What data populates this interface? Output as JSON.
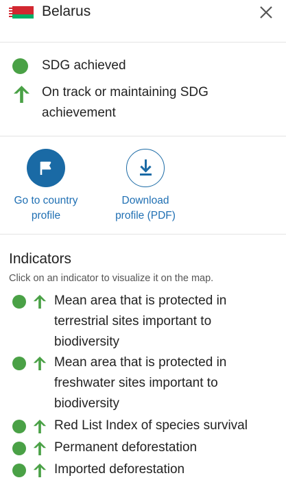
{
  "header": {
    "country": "Belarus"
  },
  "legend": [
    {
      "status": "SDG achieved"
    },
    {
      "status": "On track or maintaining SDG achievement",
      "line1": "On track or maintaining SDG",
      "line2": "achievement"
    }
  ],
  "actions": {
    "country_profile": {
      "line1": "Go to country",
      "line2": "profile"
    },
    "download": {
      "line1": "Download",
      "line2": "profile (PDF)"
    }
  },
  "indicators": {
    "title": "Indicators",
    "subtitle": "Click on an indicator to visualize it on the map.",
    "items": [
      {
        "lines": [
          "Mean area that is protected in",
          "terrestrial sites important to",
          "biodiversity"
        ]
      },
      {
        "lines": [
          "Mean area that is protected in",
          "freshwater sites important to",
          "biodiversity"
        ]
      },
      {
        "lines": [
          "Red List Index of species survival"
        ]
      },
      {
        "lines": [
          "Permanent deforestation"
        ]
      },
      {
        "lines": [
          "Imported deforestation"
        ]
      }
    ]
  },
  "colors": {
    "achieved": "#4aa146",
    "link": "#1f6fb3",
    "primary_button": "#1a6aa5"
  },
  "icons": [
    "flag-belarus-icon",
    "close-icon",
    "green-dot-icon",
    "up-arrow-icon",
    "flag-icon",
    "download-icon"
  ]
}
